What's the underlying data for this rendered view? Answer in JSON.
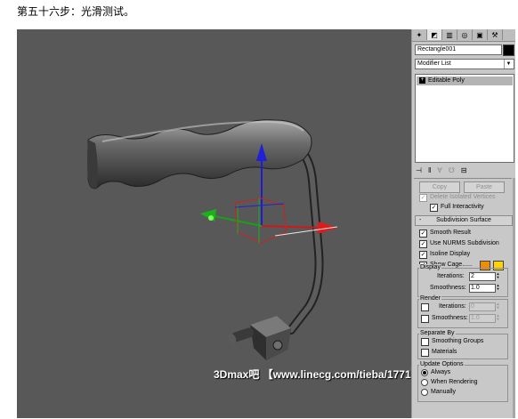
{
  "caption": "第五十六步：光滑测试。",
  "watermark": "3Dmax吧 【www.linecg.com/tieba/1771】",
  "panel": {
    "tabs": [
      "✦",
      "◩",
      "▥",
      "◎",
      "▣",
      "⚒"
    ],
    "object_name": "Rectangle001",
    "object_color": "#000000",
    "modifier_list": "Modifier List",
    "stack_item": "Editable Poly",
    "stack_tools": [
      "⊣",
      "ǁ",
      "∀",
      "☋",
      "⊟"
    ],
    "copy_label": "Copy",
    "paste_label": "Paste",
    "delete_isolated": "Delete Isolated Vertices",
    "full_interactivity": "Full Interactivity",
    "rollout_title": "Subdivision Surface",
    "rollout_toggle": "-",
    "smooth_result": "Smooth Result",
    "use_nurms": "Use NURMS Subdivision",
    "isoline_display": "Isoline Display",
    "show_cage": "Show Cage......",
    "cage_colors": [
      "#f08c00",
      "#ffd400"
    ],
    "display_group": "Display",
    "display_iterations_label": "Iterations:",
    "display_iterations_value": "2",
    "display_smoothness_label": "Smoothness:",
    "display_smoothness_value": "1.0",
    "render_group": "Render",
    "render_iterations_label": "Iterations:",
    "render_iterations_value": "0",
    "render_smoothness_label": "Smoothness:",
    "render_smoothness_value": "1.0",
    "separate_group": "Separate By",
    "smoothing_groups": "Smoothing Groups",
    "materials": "Materials",
    "update_group": "Update Options",
    "update_always": "Always",
    "update_rendering": "When Rendering",
    "update_manually": "Manually"
  }
}
